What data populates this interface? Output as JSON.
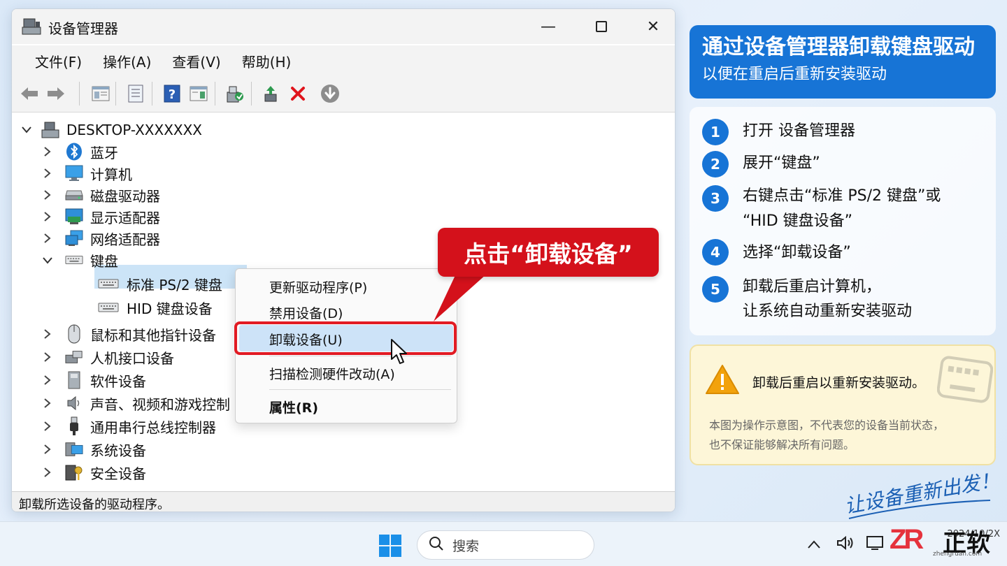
{
  "window": {
    "title": "设备管理器",
    "menu": [
      "文件(F)",
      "操作(A)",
      "查看(V)",
      "帮助(H)"
    ],
    "status": "卸载所选设备的驱动程序。"
  },
  "tree": {
    "root": "DESKTOP-XXXXXXX",
    "categories": {
      "bluetooth": "蓝牙",
      "computer": "计算机",
      "disk": "磁盘驱动器",
      "display": "显示适配器",
      "network": "网络适配器",
      "keyboard": "键盘",
      "mouse": "鼠标和其他指针设备",
      "hid": "人机接口设备",
      "software": "软件设备",
      "sound": "声音、视频和游戏控制",
      "usb": "通用串行总线控制器",
      "system": "系统设备",
      "security": "安全设备"
    },
    "keyboard_children": [
      "标准 PS/2 键盘",
      "HID 键盘设备"
    ]
  },
  "context_menu": {
    "update": "更新驱动程序(P)",
    "disable": "禁用设备(D)",
    "uninstall": "卸载设备(U)",
    "scan": "扫描检测硬件改动(A)",
    "properties": "属性(R)"
  },
  "callout": "点击“卸载设备”",
  "guide": {
    "title": "通过设备管理器卸载键盘驱动",
    "subtitle": "以便在重启后重新安装驱动",
    "steps": [
      {
        "num": "1",
        "text": "打开 设备管理器"
      },
      {
        "num": "2",
        "text": "展开“键盘”"
      },
      {
        "num": "3",
        "line1": "右键点击“标准 PS/2 键盘”或",
        "line2": "“HID 键盘设备”"
      },
      {
        "num": "4",
        "text": "选择“卸载设备”"
      },
      {
        "num": "5",
        "line1": "卸载后重启计算机，",
        "line2": "让系统自动重新安装驱动"
      }
    ],
    "warning": "卸载后重启以重新安装驱动。",
    "disclaimer_1": "本图为操作示意图，不代表您的设备当前状态，",
    "disclaimer_2": "也不保证能够解决所有问题。",
    "slogan": "让设备重新出发！"
  },
  "taskbar": {
    "search_placeholder": "搜索",
    "clock_date": "2024/10/2X"
  },
  "brand": {
    "logo": "ZR",
    "name": "正软",
    "url": "zhengruan.com"
  },
  "colors": {
    "accent_blue": "#1774d6",
    "callout_red": "#d4111b",
    "warn_bg": "#fdf6d8"
  }
}
